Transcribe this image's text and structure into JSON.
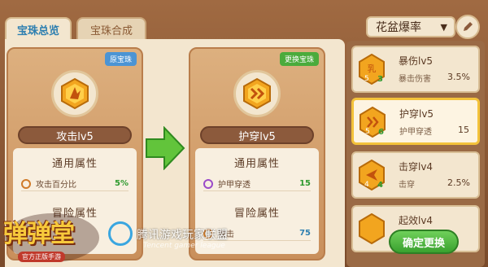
{
  "tabs": [
    {
      "label": "宝珠总览",
      "active": true
    },
    {
      "label": "宝珠合成",
      "active": false
    }
  ],
  "left_card": {
    "badge": "原宝珠",
    "gem_name": "攻击lv5",
    "section1_title": "通用属性",
    "row1_label": "攻击百分比",
    "row1_value": "5%",
    "section2_title": "冒险属性"
  },
  "right_card": {
    "badge": "更换宝珠",
    "gem_name": "护穿lv5",
    "section1_title": "通用属性",
    "row1_label": "护甲穿透",
    "row1_value": "15",
    "section2_title": "冒险属性",
    "row2_label": "攻击",
    "row2_value": "75"
  },
  "dropdown": {
    "label": "花盆爆率"
  },
  "gem_list": [
    {
      "name": "暴伤lv5",
      "desc": "暴击伤害",
      "value": "3.5%",
      "level": "3",
      "tier": "5",
      "selected": false,
      "color": "#e9a623"
    },
    {
      "name": "护穿lv5",
      "desc": "护甲穿透",
      "value": "15",
      "level": "6",
      "tier": "5",
      "selected": true,
      "color": "#e9a623"
    },
    {
      "name": "击穿lv4",
      "desc": "击穿",
      "value": "2.5%",
      "level": "4",
      "tier": "4",
      "selected": false,
      "color": "#e9a623"
    },
    {
      "name": "起效lv4",
      "desc": "",
      "value": "",
      "level": "",
      "tier": "",
      "selected": false,
      "color": "#e9a623"
    }
  ],
  "confirm_button": "确定更换",
  "logo": {
    "text": "弹弹堂",
    "sub": "官方正版手游"
  },
  "watermark": {
    "text": "腾讯游戏玩家联盟",
    "sub": "Tencent gamer league"
  },
  "colors": {
    "accent_green": "#3aa12f",
    "gold": "#f3c23a",
    "panel": "#f3e6cf"
  }
}
